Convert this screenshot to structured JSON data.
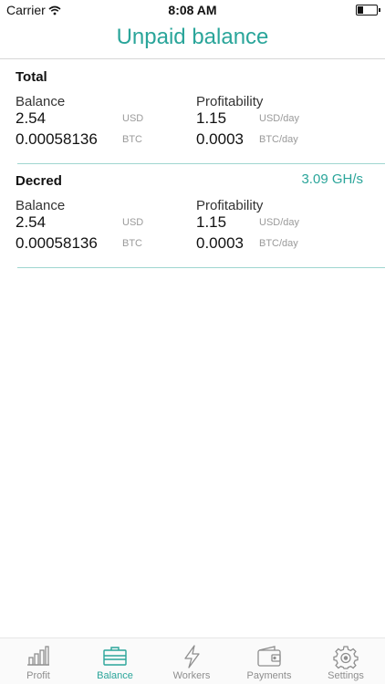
{
  "status_bar": {
    "carrier": "Carrier",
    "time": "8:08 AM"
  },
  "header": {
    "title": "Unpaid balance"
  },
  "colors": {
    "accent": "#2aa59a",
    "divider": "#9fd6d0"
  },
  "cards": [
    {
      "title": "Total",
      "rate": "",
      "balance_label": "Balance",
      "profitability_label": "Profitability",
      "balance_usd": "2.54",
      "balance_usd_unit": "USD",
      "balance_btc": "0.00058136",
      "balance_btc_unit": "BTC",
      "profit_usd": "1.15",
      "profit_usd_unit": "USD/day",
      "profit_btc": "0.0003",
      "profit_btc_unit": "BTC/day"
    },
    {
      "title": "Decred",
      "rate": "3.09 GH/s",
      "balance_label": "Balance",
      "profitability_label": "Profitability",
      "balance_usd": "2.54",
      "balance_usd_unit": "USD",
      "balance_btc": "0.00058136",
      "balance_btc_unit": "BTC",
      "profit_usd": "1.15",
      "profit_usd_unit": "USD/day",
      "profit_btc": "0.0003",
      "profit_btc_unit": "BTC/day"
    }
  ],
  "tab_bar": {
    "items": [
      {
        "label": "Profit",
        "icon": "bar-chart-icon",
        "active": false
      },
      {
        "label": "Balance",
        "icon": "briefcase-icon",
        "active": true
      },
      {
        "label": "Workers",
        "icon": "lightning-icon",
        "active": false
      },
      {
        "label": "Payments",
        "icon": "wallet-icon",
        "active": false
      },
      {
        "label": "Settings",
        "icon": "gear-icon",
        "active": false
      }
    ]
  }
}
